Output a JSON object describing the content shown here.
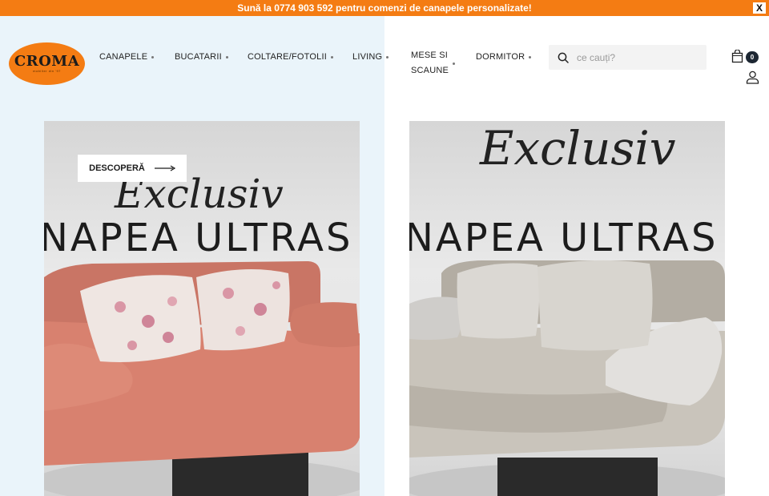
{
  "announcement": {
    "text": "Sună la 0774 903 592 pentru comenzi de canapele personalizate!",
    "close_label": "X"
  },
  "logo": {
    "word": "CROMA",
    "tagline": "mobilier din '97"
  },
  "nav": {
    "items": [
      {
        "label": "CANAPELE"
      },
      {
        "label": "BUCATARII"
      },
      {
        "label": "COLTARE/FOTOLII"
      },
      {
        "label": "LIVING"
      },
      {
        "label_line1": "MESE SI",
        "label_line2": "SCAUNE"
      },
      {
        "label": "DORMITOR"
      }
    ]
  },
  "search": {
    "placeholder": "ce cauți?",
    "icon": "search-icon"
  },
  "cart": {
    "count": "0",
    "icon": "shopping-bag-icon"
  },
  "account": {
    "icon": "user-icon"
  },
  "hero": {
    "cta_label": "DESCOPERĂ",
    "slides": [
      {
        "script_text": "Exclusiv",
        "headline": "NAPEA ULTRAS",
        "sofa_color": "#d8816f",
        "cushion_color": "#efe6e2"
      },
      {
        "script_text": "Exclusiv",
        "headline": "NAPEA ULTRAS",
        "sofa_color": "#c9c4bb",
        "cushion_color": "#dbd8d3"
      }
    ]
  },
  "colors": {
    "accent": "#f47c13",
    "left_bg": "#eaf4fa",
    "badge": "#1d2733"
  }
}
